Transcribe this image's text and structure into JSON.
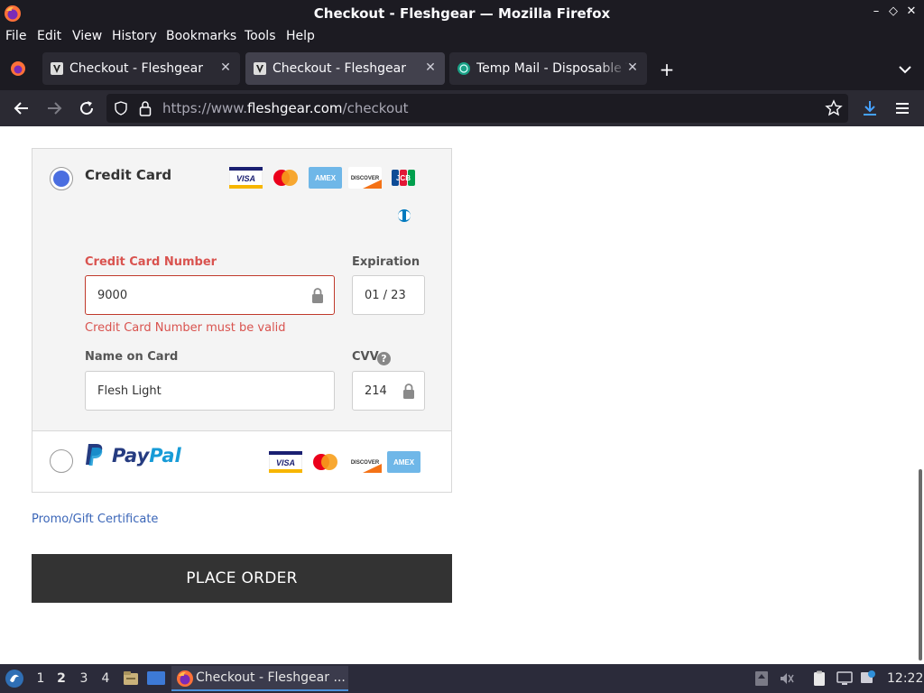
{
  "window": {
    "title": "Checkout - Fleshgear — Mozilla Firefox",
    "controls": [
      "minimize",
      "maximize",
      "close"
    ]
  },
  "menu": [
    {
      "label": "File",
      "key": "F"
    },
    {
      "label": "Edit",
      "key": "E"
    },
    {
      "label": "View",
      "key": "V"
    },
    {
      "label": "History",
      "key": "H"
    },
    {
      "label": "Bookmarks",
      "key": "B"
    },
    {
      "label": "Tools",
      "key": "T"
    },
    {
      "label": "Help",
      "key": "H"
    }
  ],
  "tabs": [
    {
      "label": "Checkout - Fleshgear",
      "active": false
    },
    {
      "label": "Checkout - Fleshgear",
      "active": true
    },
    {
      "label": "Temp Mail - Disposable Te",
      "active": false
    }
  ],
  "urlbar": {
    "prefix": "https://www.",
    "host": "fleshgear.com",
    "path": "/checkout"
  },
  "payment": {
    "credit_card": {
      "title": "Credit Card",
      "selected": true,
      "card_logos": [
        "VISA",
        "mastercard",
        "AMEX",
        "DISCOVER",
        "JCB",
        "diners"
      ],
      "number_label": "Credit Card Number",
      "number_value": "9000",
      "number_error": "Credit Card Number must be valid",
      "expiration_label": "Expiration",
      "expiration_value": "01 / 23",
      "name_label": "Name on Card",
      "name_value": "Flesh Light",
      "cvv_label": "CVV",
      "cvv_help": "?",
      "cvv_value": "214"
    },
    "paypal": {
      "selected": false,
      "logo_a": "Pay",
      "logo_b": "Pal",
      "card_logos": [
        "VISA",
        "mastercard",
        "DISCOVER",
        "AMEX"
      ]
    }
  },
  "promo_link": "Promo/Gift Certificate",
  "place_order": "PLACE ORDER",
  "colors": {
    "accent_blue": "#4a6ee0",
    "error_red": "#d9534f",
    "button_dark": "#333333"
  },
  "taskbar": {
    "workspaces": [
      "1",
      "2",
      "3",
      "4"
    ],
    "active_workspace": "2",
    "task_label": "Checkout - Fleshgear ...",
    "clock": "12:22"
  }
}
